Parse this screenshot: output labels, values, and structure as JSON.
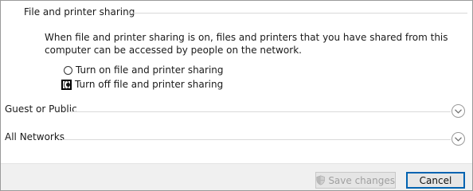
{
  "group": {
    "title": "File and printer sharing",
    "description": "When file and printer sharing is on, files and printers that you have shared from this computer can be accessed by people on the network."
  },
  "options": [
    {
      "label": "Turn on file and printer sharing",
      "selected": false
    },
    {
      "label": "Turn off file and printer sharing",
      "selected": true
    }
  ],
  "sections": [
    {
      "label": "Guest or Public",
      "icon": "chevron-down-icon"
    },
    {
      "label": "All Networks",
      "icon": "chevron-down-icon"
    }
  ],
  "footer": {
    "save_label": "Save changes",
    "save_enabled": false,
    "save_icon": "shield-icon",
    "cancel_label": "Cancel",
    "accent_color": "#0063b1"
  }
}
